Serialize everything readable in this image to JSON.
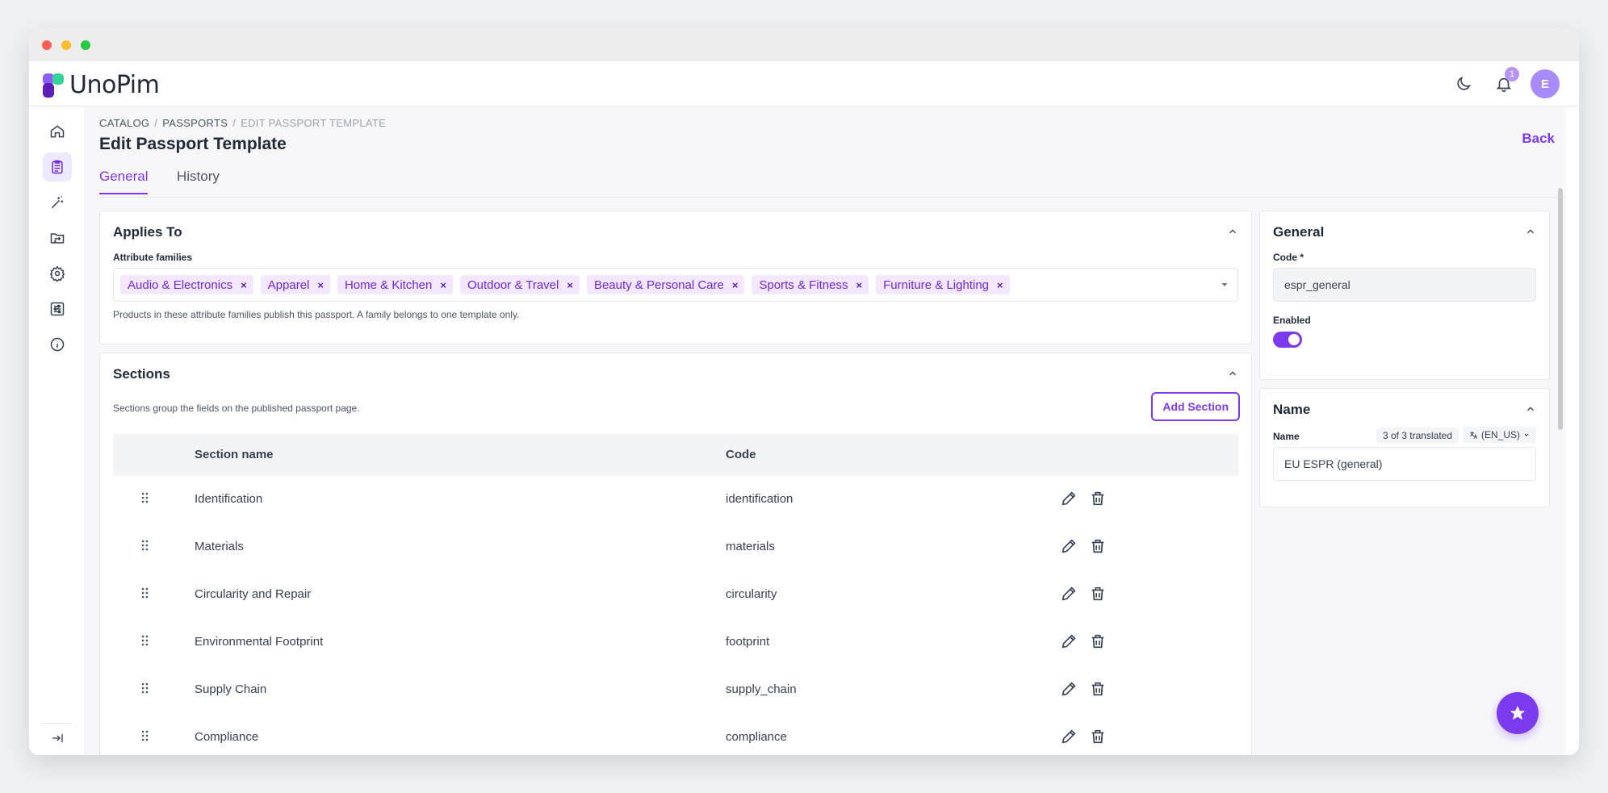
{
  "app": {
    "name": "UnoPim"
  },
  "topbar": {
    "notification_count": "1",
    "user_initial": "E"
  },
  "breadcrumb": {
    "items": [
      "CATALOG",
      "PASSPORTS"
    ],
    "current": "EDIT PASSPORT TEMPLATE"
  },
  "page": {
    "title": "Edit Passport Template",
    "back_label": "Back"
  },
  "tabs": [
    {
      "label": "General",
      "active": true
    },
    {
      "label": "History",
      "active": false
    }
  ],
  "applies_to": {
    "title": "Applies To",
    "field_label": "Attribute families",
    "chips": [
      "Audio & Electronics",
      "Apparel",
      "Home & Kitchen",
      "Outdoor & Travel",
      "Beauty & Personal Care",
      "Sports & Fitness",
      "Furniture & Lighting"
    ],
    "remove_glyph": "×",
    "help": "Products in these attribute families publish this passport. A family belongs to one template only."
  },
  "sections": {
    "title": "Sections",
    "description": "Sections group the fields on the published passport page.",
    "add_label": "Add Section",
    "columns": [
      "Section name",
      "Code"
    ],
    "rows": [
      {
        "name": "Identification",
        "code": "identification"
      },
      {
        "name": "Materials",
        "code": "materials"
      },
      {
        "name": "Circularity and Repair",
        "code": "circularity"
      },
      {
        "name": "Environmental Footprint",
        "code": "footprint"
      },
      {
        "name": "Supply Chain",
        "code": "supply_chain"
      },
      {
        "name": "Compliance",
        "code": "compliance"
      }
    ]
  },
  "general": {
    "title": "General",
    "code_label": "Code *",
    "code_value": "espr_general",
    "enabled_label": "Enabled",
    "enabled": true
  },
  "name_panel": {
    "title": "Name",
    "field_label": "Name",
    "translated": "3 of 3 translated",
    "locale": "(EN_US)",
    "value": "EU ESPR (general)"
  },
  "colors": {
    "accent": "#7c3aed",
    "chip_bg": "#f3e8ff"
  },
  "icons": [
    "home-icon",
    "catalog-icon",
    "magic-wand-icon",
    "data-transfer-icon",
    "gear-icon",
    "sliders-icon",
    "info-icon",
    "collapse-sidebar-icon",
    "moon-icon",
    "bell-icon",
    "star-icon",
    "pencil-icon",
    "trash-icon",
    "drag-handle-icon",
    "chevron-up-icon",
    "chevron-down-icon",
    "translate-icon"
  ]
}
